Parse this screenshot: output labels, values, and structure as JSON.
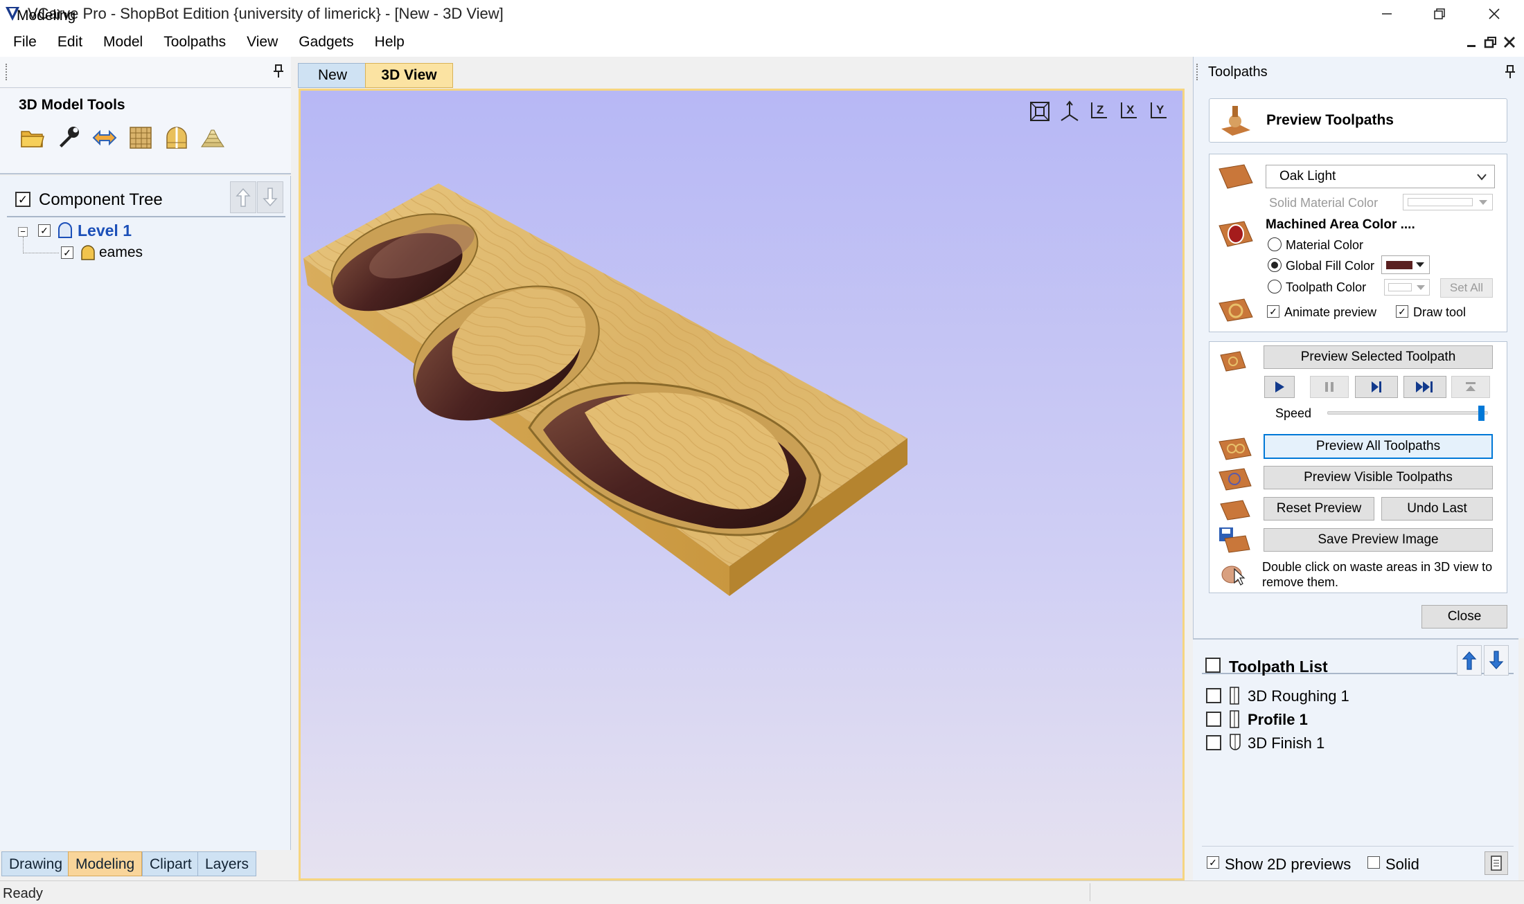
{
  "window": {
    "title": "VCarve Pro - ShopBot Edition {university of limerick} - [New - 3D View]"
  },
  "menu": [
    "File",
    "Edit",
    "Model",
    "Toolpaths",
    "View",
    "Gadgets",
    "Help"
  ],
  "left_panel": {
    "title": "Modeling",
    "tools_title": "3D Model Tools",
    "tools": [
      "open-folder-icon",
      "wrench-icon",
      "transform-arrows-icon",
      "texture-grid-icon",
      "component-split-icon",
      "stack-layers-icon"
    ],
    "tree": {
      "title": "Component Tree",
      "level": "Level 1",
      "items": [
        "eames"
      ]
    },
    "tabs": [
      "Drawing",
      "Modeling",
      "Clipart",
      "Layers"
    ],
    "active_tab": "Modeling"
  },
  "document_tabs": [
    "New",
    "3D View"
  ],
  "active_document_tab": "3D View",
  "view_icons": [
    "fit-view-icon",
    "iso-view-icon",
    "view-z-icon",
    "view-x-icon",
    "view-y-icon"
  ],
  "right_panel": {
    "title": "Toolpaths",
    "preview_title": "Preview Toolpaths",
    "material": {
      "selected": "Oak Light",
      "solid_color_label": "Solid Material Color",
      "machined_title": "Machined Area Color ....",
      "options": [
        "Material Color",
        "Global Fill Color",
        "Toolpath Color"
      ],
      "selected_option": "Global Fill Color",
      "set_all": "Set All",
      "animate_preview": "Animate preview",
      "draw_tool": "Draw tool",
      "fill_color": "#5a2020"
    },
    "controls": {
      "preview_selected": "Preview Selected Toolpath",
      "speed_label": "Speed",
      "speed_fraction": 0.98,
      "preview_all": "Preview All Toolpaths",
      "preview_visible": "Preview Visible Toolpaths",
      "reset_preview": "Reset Preview",
      "undo_last": "Undo Last",
      "save_image": "Save Preview Image",
      "hint": "Double click on waste areas in 3D view to remove them."
    },
    "close": "Close",
    "toolpath_list": {
      "title": "Toolpath List",
      "items": [
        "3D Roughing 1",
        "Profile 1",
        "3D Finish 1"
      ],
      "show_2d": "Show 2D previews",
      "solid": "Solid"
    }
  },
  "status": "Ready"
}
